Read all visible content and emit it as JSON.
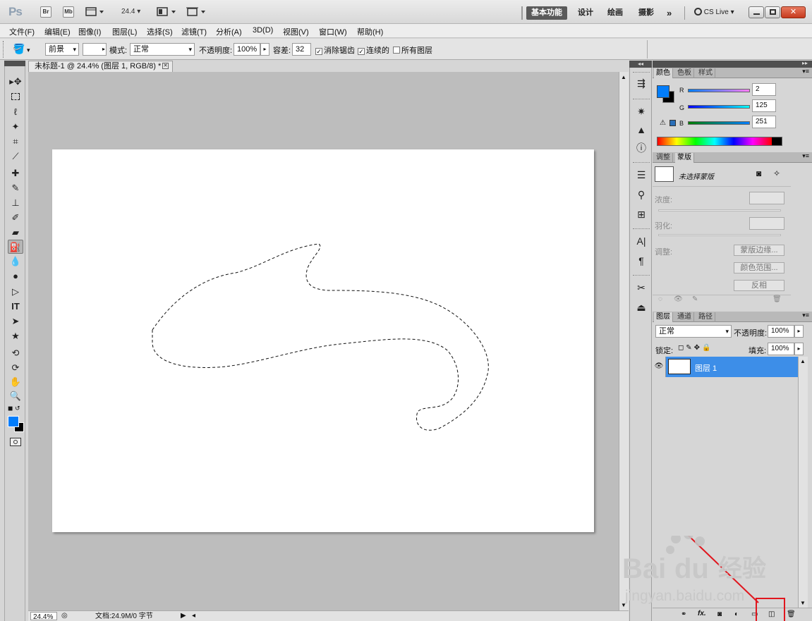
{
  "app": {
    "logo": "Ps"
  },
  "titlebar": {
    "bridge_btn": "Br",
    "minibridge_btn": "Mb",
    "zoom_value": "24.4",
    "workspaces": [
      "基本功能",
      "设计",
      "绘画",
      "摄影"
    ],
    "more": "»",
    "cslive": "CS Live"
  },
  "menu": [
    "文件(F)",
    "编辑(E)",
    "图像(I)",
    "图层(L)",
    "选择(S)",
    "滤镜(T)",
    "分析(A)",
    "3D(D)",
    "视图(V)",
    "窗口(W)",
    "帮助(H)"
  ],
  "options": {
    "fill_source": "前景",
    "mode_label": "模式:",
    "mode_value": "正常",
    "opacity_label": "不透明度:",
    "opacity_value": "100%",
    "tolerance_label": "容差:",
    "tolerance_value": "32",
    "antialias_label": "消除锯齿",
    "contiguous_label": "连续的",
    "alllayers_label": "所有图层"
  },
  "document": {
    "tab_title": "未标题-1 @ 24.4% (图层 1, RGB/8) *",
    "zoom": "24.4%",
    "doc_info": "文档:24.9M/0 字节"
  },
  "color_panel": {
    "tabs": [
      "颜色",
      "色板",
      "样式"
    ],
    "fg_color": "#027dfb",
    "r_label": "R",
    "r_value": "2",
    "g_label": "G",
    "g_value": "125",
    "b_label": "B",
    "b_value": "251"
  },
  "masks_panel": {
    "tabs": [
      "调整",
      "蒙版"
    ],
    "no_mask": "未选择蒙版",
    "density": "浓度:",
    "feather": "羽化:",
    "refine": "调整:",
    "mask_edge": "蒙版边缘...",
    "color_range": "颜色范围...",
    "invert": "反相"
  },
  "layers_panel": {
    "tabs": [
      "图层",
      "通道",
      "路径"
    ],
    "blend_mode": "正常",
    "opacity_label": "不透明度:",
    "opacity_value": "100%",
    "lock_label": "锁定:",
    "fill_label": "填充:",
    "fill_value": "100%",
    "layer_name": "图层 1",
    "fx": "fx."
  },
  "watermark": {
    "brand": "Bai",
    "brand2": "du",
    "cn": "经验",
    "url": "jingyan.baidu.com"
  }
}
